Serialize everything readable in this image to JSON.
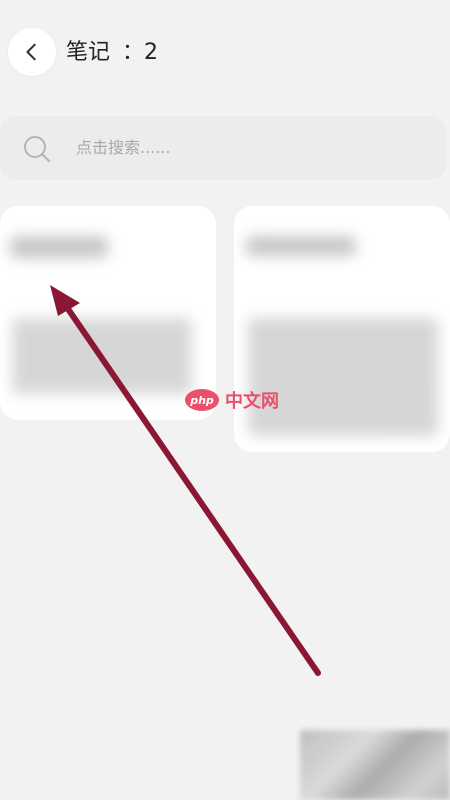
{
  "header": {
    "title": "笔记",
    "count": "：2",
    "back_icon": "chevron-left-icon"
  },
  "search": {
    "icon": "search-icon",
    "placeholder": "点击搜索......"
  },
  "watermark": {
    "logo_text": "php",
    "text": "中文网"
  },
  "annotation": {
    "arrow_color": "#8a1733"
  }
}
